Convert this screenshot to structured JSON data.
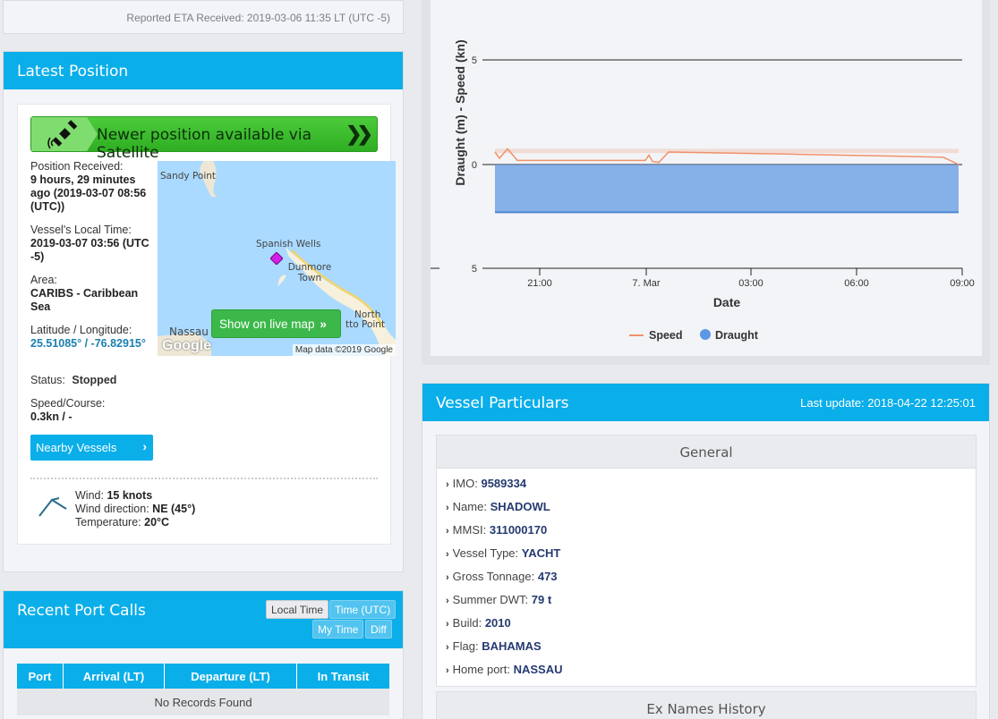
{
  "eta": {
    "text": "Reported ETA Received: 2019-03-06 11:35 LT (UTC -5)"
  },
  "latest_position": {
    "title": "Latest Position",
    "satellite_banner": "Newer position available via Satellite",
    "fields": [
      {
        "label": "Position Received:",
        "value": "9 hours, 29 minutes ago (2019-03-07 08:56 (UTC))"
      },
      {
        "label": "Vessel's Local Time:",
        "value": "2019-03-07 03:56 (UTC -5)"
      },
      {
        "label": "Area:",
        "value": "CARIBS - Caribbean Sea"
      },
      {
        "label": "Latitude / Longitude:",
        "value": "25.51085° / -76.82915°"
      },
      {
        "label": "Status:",
        "value": "Stopped"
      },
      {
        "label": "Speed/Course:",
        "value": "0.3kn / -"
      }
    ],
    "map": {
      "places": [
        "Sandy Point",
        "Spanish Wells",
        "Dunmore Town",
        "Nassau",
        "North",
        "tto Point"
      ],
      "live_map_button": "Show on live map",
      "credit": "Map data ©2019 Google",
      "logo": "Google"
    },
    "nearby_button": "Nearby Vessels",
    "weather": {
      "wind_label": "Wind:",
      "wind_value": "15  knots",
      "direction_label": "Wind direction:",
      "direction_value": "NE (45°)",
      "temp_label": "Temperature:",
      "temp_value": "20°C"
    }
  },
  "port_calls": {
    "title": "Recent Port Calls",
    "buttons": [
      "Local Time",
      "Time (UTC)",
      "My Time",
      "Diff"
    ],
    "columns": [
      "Port",
      "Arrival (LT)",
      "Departure (LT)",
      "In Transit"
    ],
    "empty": "No Records Found"
  },
  "chart_data": {
    "type": "line",
    "ylabel": "Draught (m) - Speed (kn)",
    "xlabel": "Date",
    "y_ticks": [
      "5",
      "0",
      "5"
    ],
    "x_ticks": [
      "21:00",
      "7. Mar",
      "03:00",
      "06:00",
      "09:00"
    ],
    "legend": [
      "Speed",
      "Draught"
    ],
    "series": [
      {
        "name": "Speed",
        "color": "#f0916a",
        "values": [
          0.6,
          0.3,
          0.75,
          0.2,
          0.2,
          0.2,
          0.2,
          0.45,
          0.15,
          0.1,
          0.6,
          0.55,
          0.5,
          0.45,
          0.4,
          0.35,
          0.0
        ]
      },
      {
        "name": "Draught",
        "color": "#6a9fe4",
        "values": [
          -2.3,
          -2.3,
          -2.3,
          -2.3,
          -2.3,
          -2.3,
          -2.3,
          -2.3,
          -2.3,
          -2.3,
          -2.3,
          -2.3,
          -2.3,
          -2.3,
          -2.3,
          -2.3,
          -2.3
        ]
      }
    ],
    "ylim": [
      -5,
      5
    ]
  },
  "particulars": {
    "title": "Vessel Particulars",
    "last_update": "Last update: 2018-04-22 12:25:01",
    "general_title": "General",
    "rows": [
      {
        "label": "IMO:",
        "value": "9589334"
      },
      {
        "label": "Name:",
        "value": "SHADOWL"
      },
      {
        "label": "MMSI:",
        "value": "311000170"
      },
      {
        "label": "Vessel Type:",
        "value": "YACHT"
      },
      {
        "label": "Gross Tonnage:",
        "value": "473"
      },
      {
        "label": "Summer DWT:",
        "value": "79 t"
      },
      {
        "label": "Build:",
        "value": "2010"
      },
      {
        "label": "Flag:",
        "value": "BAHAMAS"
      },
      {
        "label": "Home port:",
        "value": "NASSAU"
      }
    ],
    "ex_names": "Ex Names History"
  }
}
